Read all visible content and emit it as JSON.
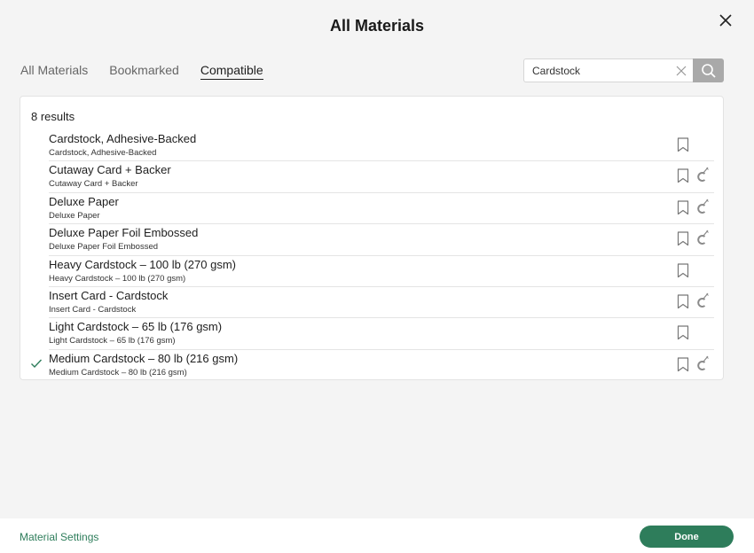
{
  "header": {
    "title": "All Materials"
  },
  "tabs": [
    {
      "label": "All Materials",
      "active": false
    },
    {
      "label": "Bookmarked",
      "active": false
    },
    {
      "label": "Compatible",
      "active": true
    }
  ],
  "search": {
    "value": "Cardstock",
    "placeholder": "Search"
  },
  "results": {
    "count_label": "8 results",
    "items": [
      {
        "name": "Cardstock, Adhesive-Backed",
        "sub": "Cardstock, Adhesive-Backed",
        "selected": false,
        "compatible_icon": false
      },
      {
        "name": "Cutaway Card + Backer",
        "sub": "Cutaway Card + Backer",
        "selected": false,
        "compatible_icon": true
      },
      {
        "name": "Deluxe Paper",
        "sub": "Deluxe Paper",
        "selected": false,
        "compatible_icon": true
      },
      {
        "name": "Deluxe Paper Foil Embossed",
        "sub": "Deluxe Paper Foil Embossed",
        "selected": false,
        "compatible_icon": true
      },
      {
        "name": "Heavy Cardstock – 100 lb (270 gsm)",
        "sub": "Heavy Cardstock – 100 lb (270 gsm)",
        "selected": false,
        "compatible_icon": false
      },
      {
        "name": "Insert Card - Cardstock",
        "sub": "Insert Card - Cardstock",
        "selected": false,
        "compatible_icon": true
      },
      {
        "name": "Light Cardstock – 65 lb (176 gsm)",
        "sub": "Light Cardstock – 65 lb (176 gsm)",
        "selected": false,
        "compatible_icon": false
      },
      {
        "name": "Medium Cardstock – 80 lb (216 gsm)",
        "sub": "Medium Cardstock – 80 lb (216 gsm)",
        "selected": true,
        "compatible_icon": true
      }
    ]
  },
  "footer": {
    "settings_label": "Material Settings",
    "done_label": "Done"
  },
  "colors": {
    "accent": "#2e7d5b",
    "background": "#f4f4f4",
    "search_button": "#a9a9a9"
  },
  "icons": {
    "close": "close-icon",
    "clear": "clear-icon",
    "search": "search-icon",
    "bookmark": "bookmark-icon",
    "check": "check-icon",
    "compatible": "compatible-tool-icon"
  }
}
